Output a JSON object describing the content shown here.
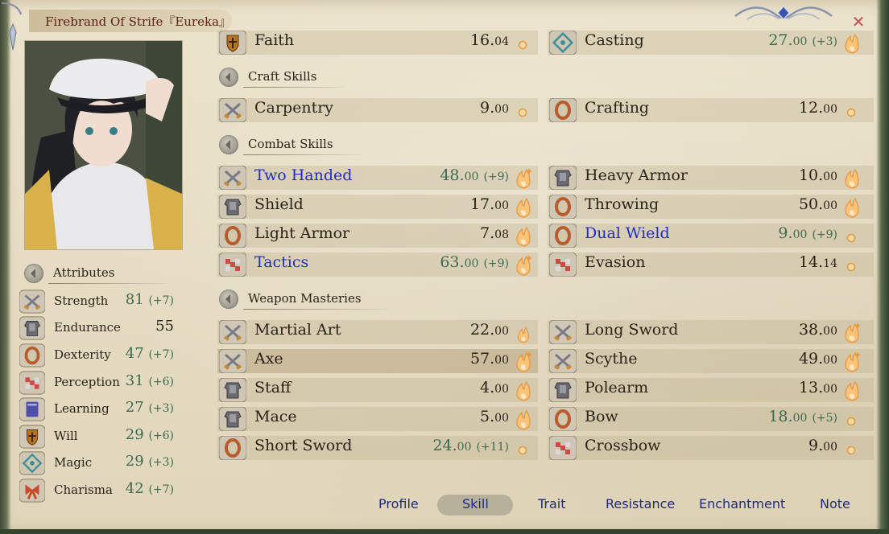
{
  "window": {
    "title": "Firebrand Of Strife『Eureka』",
    "close_glyph": "✕"
  },
  "attributes": {
    "header": "Attributes",
    "items": [
      {
        "label": "Strength",
        "value": "81",
        "bonus": "(+7)",
        "icon": "crossed-swords-icon",
        "icon_color": "#c58a3a"
      },
      {
        "label": "Endurance",
        "value": "55",
        "bonus": "",
        "icon": "armor-icon",
        "icon_color": "#8a8a8a"
      },
      {
        "label": "Dexterity",
        "value": "47",
        "bonus": "(+7)",
        "icon": "ring-icon",
        "icon_color": "#b85c2a"
      },
      {
        "label": "Perception",
        "value": "31",
        "bonus": "(+6)",
        "icon": "dots-icon",
        "icon_color": "#d04848"
      },
      {
        "label": "Learning",
        "value": "27",
        "bonus": "(+3)",
        "icon": "book-icon",
        "icon_color": "#5050a8"
      },
      {
        "label": "Will",
        "value": "29",
        "bonus": "(+6)",
        "icon": "shield-icon",
        "icon_color": "#b8741e"
      },
      {
        "label": "Magic",
        "value": "29",
        "bonus": "(+3)",
        "icon": "rune-icon",
        "icon_color": "#3f8f9a"
      },
      {
        "label": "Charisma",
        "value": "42",
        "bonus": "(+7)",
        "icon": "ribbon-icon",
        "icon_color": "#c84a2a"
      }
    ]
  },
  "top_skills": [
    {
      "name": "Faith",
      "value": "16.",
      "dec": "04",
      "bonus": "",
      "green": false,
      "blue": false,
      "potential": "small",
      "icon": "shield-icon",
      "icon_color": "#b8741e"
    },
    {
      "name": "Casting",
      "value": "27.",
      "dec": "00",
      "bonus": "(+3)",
      "green": true,
      "blue": false,
      "potential": "flame",
      "icon": "rune-icon",
      "icon_color": "#3f8f9a"
    }
  ],
  "craft_skills": {
    "header": "Craft Skills",
    "items": [
      {
        "name": "Carpentry",
        "value": "9.",
        "dec": "00",
        "bonus": "",
        "green": false,
        "blue": false,
        "potential": "small",
        "icon": "crossed-swords-icon",
        "icon_color": "#c58a3a"
      },
      {
        "name": "Crafting",
        "value": "12.",
        "dec": "00",
        "bonus": "",
        "green": false,
        "blue": false,
        "potential": "small",
        "icon": "ring-icon",
        "icon_color": "#b85c2a"
      }
    ]
  },
  "combat_skills": {
    "header": "Combat Skills",
    "items": [
      {
        "name": "Two Handed",
        "value": "48.",
        "dec": "00",
        "bonus": "(+9)",
        "green": true,
        "blue": true,
        "potential": "flame-plus",
        "icon": "crossed-swords-icon",
        "icon_color": "#c58a3a"
      },
      {
        "name": "Heavy Armor",
        "value": "10.",
        "dec": "00",
        "bonus": "",
        "green": false,
        "blue": false,
        "potential": "flame",
        "icon": "armor-icon",
        "icon_color": "#8a8a8a"
      },
      {
        "name": "Shield",
        "value": "17.",
        "dec": "00",
        "bonus": "",
        "green": false,
        "blue": false,
        "potential": "flame",
        "icon": "armor-icon",
        "icon_color": "#8a8a8a"
      },
      {
        "name": "Throwing",
        "value": "50.",
        "dec": "00",
        "bonus": "",
        "green": false,
        "blue": false,
        "potential": "flame",
        "icon": "ring-icon",
        "icon_color": "#b85c2a"
      },
      {
        "name": "Light Armor",
        "value": "7.",
        "dec": "08",
        "bonus": "",
        "green": false,
        "blue": false,
        "potential": "flame",
        "icon": "ring-icon",
        "icon_color": "#b85c2a"
      },
      {
        "name": "Dual Wield",
        "value": "9.",
        "dec": "00",
        "bonus": "(+9)",
        "green": true,
        "blue": true,
        "potential": "small",
        "icon": "ring-icon",
        "icon_color": "#b85c2a"
      },
      {
        "name": "Tactics",
        "value": "63.",
        "dec": "00",
        "bonus": "(+9)",
        "green": true,
        "blue": true,
        "potential": "flame-plus",
        "icon": "dots-icon",
        "icon_color": "#d04848"
      },
      {
        "name": "Evasion",
        "value": "14.",
        "dec": "14",
        "bonus": "",
        "green": false,
        "blue": false,
        "potential": "small",
        "icon": "dots-icon",
        "icon_color": "#d04848"
      }
    ]
  },
  "weapon_masteries": {
    "header": "Weapon Masteries",
    "items": [
      {
        "name": "Martial Art",
        "value": "22.",
        "dec": "00",
        "bonus": "",
        "green": false,
        "blue": false,
        "potential": "flame-small",
        "icon": "crossed-swords-icon",
        "icon_color": "#c58a3a"
      },
      {
        "name": "Long Sword",
        "value": "38.",
        "dec": "00",
        "bonus": "",
        "green": false,
        "blue": false,
        "potential": "flame-plus",
        "icon": "crossed-swords-icon",
        "icon_color": "#c58a3a"
      },
      {
        "name": "Axe",
        "value": "57.",
        "dec": "00",
        "bonus": "",
        "green": false,
        "blue": false,
        "potential": "flame-plus",
        "icon": "crossed-swords-icon",
        "icon_color": "#c58a3a"
      },
      {
        "name": "Scythe",
        "value": "49.",
        "dec": "00",
        "bonus": "",
        "green": false,
        "blue": false,
        "potential": "flame-plus",
        "icon": "crossed-swords-icon",
        "icon_color": "#c58a3a"
      },
      {
        "name": "Staff",
        "value": "4.",
        "dec": "00",
        "bonus": "",
        "green": false,
        "blue": false,
        "potential": "flame",
        "icon": "armor-icon",
        "icon_color": "#8a8a8a"
      },
      {
        "name": "Polearm",
        "value": "13.",
        "dec": "00",
        "bonus": "",
        "green": false,
        "blue": false,
        "potential": "flame",
        "icon": "armor-icon",
        "icon_color": "#8a8a8a"
      },
      {
        "name": "Mace",
        "value": "5.",
        "dec": "00",
        "bonus": "",
        "green": false,
        "blue": false,
        "potential": "flame",
        "icon": "armor-icon",
        "icon_color": "#8a8a8a"
      },
      {
        "name": "Bow",
        "value": "18.",
        "dec": "00",
        "bonus": "(+5)",
        "green": true,
        "blue": false,
        "potential": "small",
        "icon": "ring-icon",
        "icon_color": "#b85c2a"
      },
      {
        "name": "Short Sword",
        "value": "24.",
        "dec": "00",
        "bonus": "(+11)",
        "green": true,
        "blue": false,
        "potential": "small",
        "icon": "ring-icon",
        "icon_color": "#b85c2a"
      },
      {
        "name": "Crossbow",
        "value": "9.",
        "dec": "00",
        "bonus": "",
        "green": false,
        "blue": false,
        "potential": "small",
        "icon": "dots-icon",
        "icon_color": "#d04848"
      }
    ]
  },
  "tabs": [
    {
      "label": "Profile",
      "active": false
    },
    {
      "label": "Skill",
      "active": true
    },
    {
      "label": "Trait",
      "active": false
    },
    {
      "label": "Resistance",
      "active": false
    },
    {
      "label": "Enchantment",
      "active": false
    },
    {
      "label": "Note",
      "active": false
    }
  ],
  "colors": {
    "name_blue": "#1d2ec0",
    "value_green": "#3d6b4f",
    "title_red": "#5a1f16",
    "tab_blue": "#1e2a7a"
  }
}
